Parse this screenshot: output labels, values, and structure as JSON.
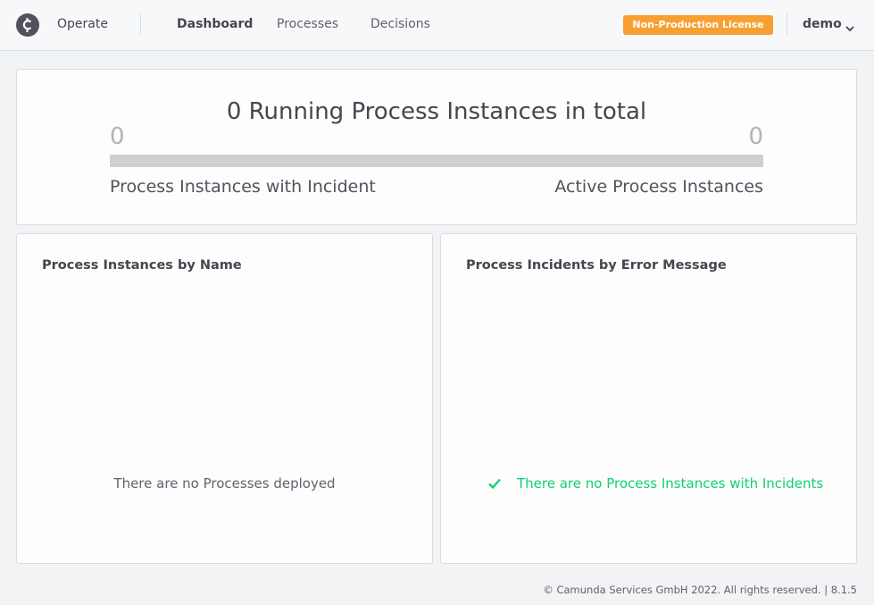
{
  "header": {
    "app_name": "Operate",
    "nav": {
      "dashboard": "Dashboard",
      "processes": "Processes",
      "decisions": "Decisions"
    },
    "license_badge": "Non-Production License",
    "user": "demo",
    "logo_icon": "camunda-logo-icon"
  },
  "summary": {
    "title": "0 Running Process Instances in total",
    "incident_count": "0",
    "active_count": "0",
    "incident_label": "Process Instances with Incident",
    "active_label": "Active Process Instances"
  },
  "cards": {
    "by_name": {
      "title": "Process Instances by Name",
      "message": "There are no Processes deployed"
    },
    "by_error": {
      "title": "Process Incidents by Error Message",
      "message": "There are no Process Instances with Incidents"
    }
  },
  "footer": "© Camunda Services GmbH 2022. All rights reserved. | 8.1.5",
  "colors": {
    "badge": "#f7a030",
    "success": "#10d070",
    "bar": "#cfcfd1"
  }
}
